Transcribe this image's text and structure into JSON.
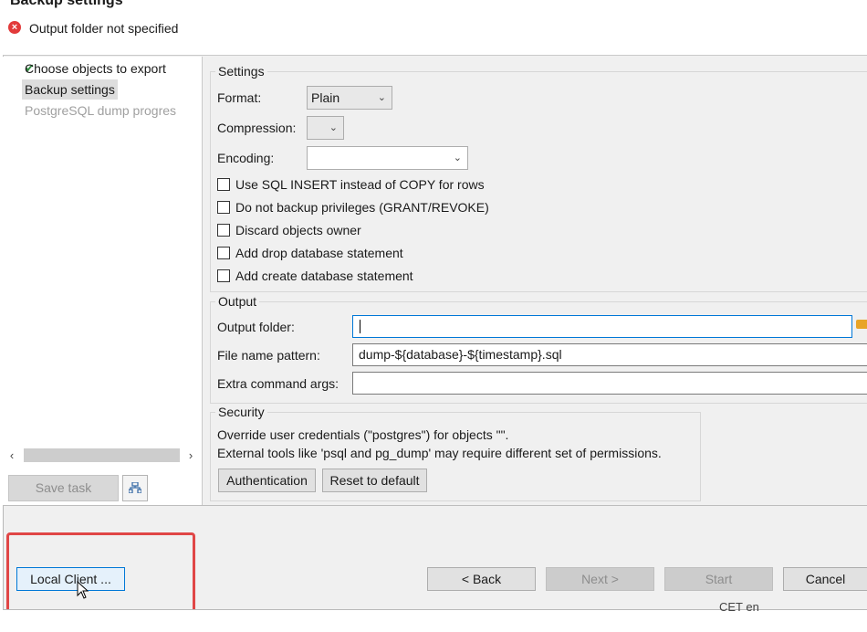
{
  "dialog": {
    "title": "Backup settings",
    "error_message": "Output folder not specified"
  },
  "nav": {
    "items": [
      {
        "label": "Choose objects to export",
        "state": "done"
      },
      {
        "label": "Backup settings",
        "state": "selected"
      },
      {
        "label": "PostgreSQL dump progres",
        "state": "disabled"
      }
    ],
    "save_task_label": "Save task"
  },
  "settings": {
    "group_title": "Settings",
    "format_label": "Format:",
    "format_value": "Plain",
    "compression_label": "Compression:",
    "compression_value": "",
    "encoding_label": "Encoding:",
    "encoding_value": "",
    "checkboxes": [
      {
        "label": "Use SQL INSERT instead of COPY for rows",
        "checked": false
      },
      {
        "label": "Do not backup privileges (GRANT/REVOKE)",
        "checked": false
      },
      {
        "label": "Discard objects owner",
        "checked": false
      },
      {
        "label": "Add drop database statement",
        "checked": false
      },
      {
        "label": "Add create database statement",
        "checked": false
      }
    ]
  },
  "output": {
    "group_title": "Output",
    "folder_label": "Output folder:",
    "folder_value": "",
    "pattern_label": "File name pattern:",
    "pattern_value": "dump-${database}-${timestamp}.sql",
    "args_label": "Extra command args:",
    "args_value": ""
  },
  "security": {
    "group_title": "Security",
    "line1": "Override user credentials (\"postgres\") for objects \"\".",
    "line2": "External tools like 'psql and pg_dump' may require different set of permissions.",
    "auth_button": "Authentication",
    "reset_button": "Reset to default"
  },
  "footer": {
    "local_client": "Local Client ...",
    "back": "< Back",
    "next": "Next >",
    "start": "Start",
    "cancel": "Cancel"
  },
  "taskbar": {
    "text": "CET  en"
  },
  "colors": {
    "accent": "#0078d7",
    "error": "#e23a3a",
    "highlight": "#e04646",
    "check": "#2e8b3e"
  }
}
